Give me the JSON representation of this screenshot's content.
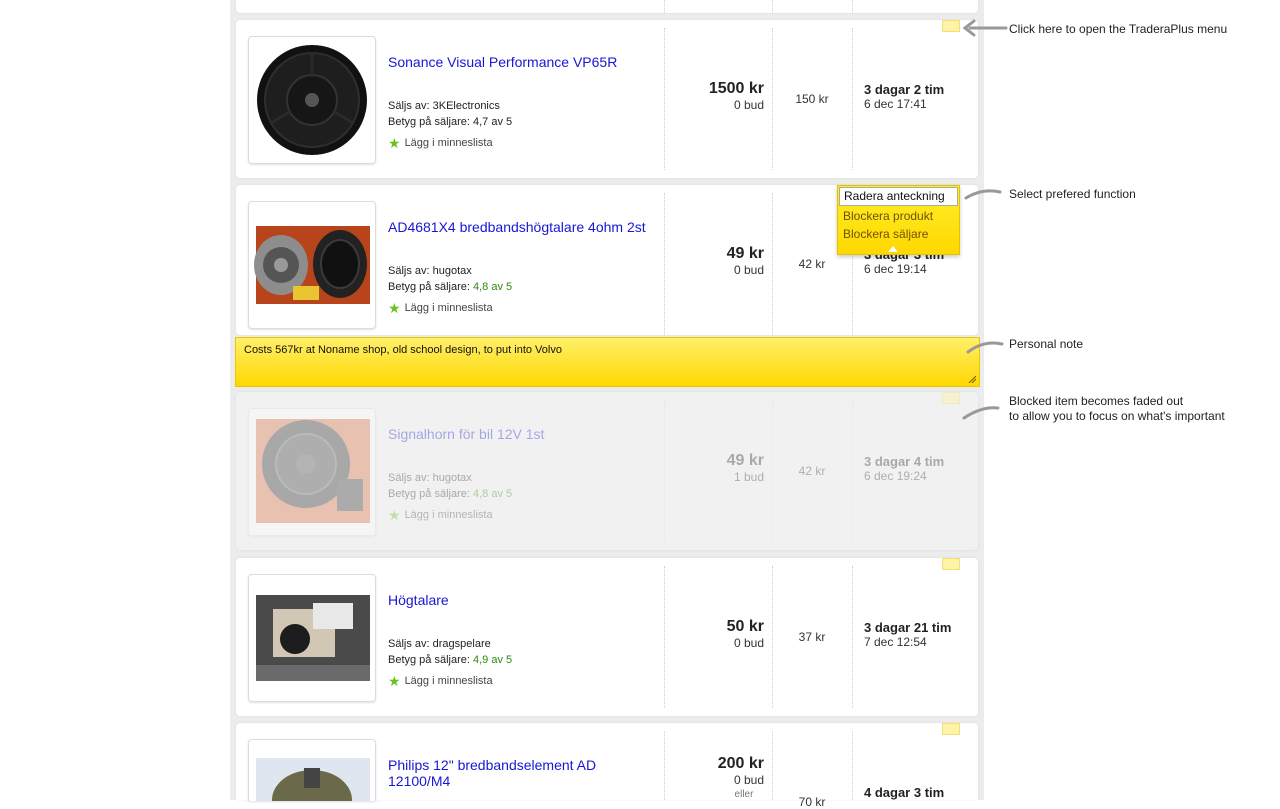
{
  "annotations": {
    "menu_hint": "Click here to open the TraderaPlus menu",
    "select_hint": "Select prefered function",
    "note_hint": "Personal note",
    "blocked_hint_line1": "Blocked item becomes faded out",
    "blocked_hint_line2": "to allow you to focus on what's important"
  },
  "menu": {
    "selected": "Radera anteckning",
    "options": [
      "Blockera produkt",
      "Blockera säljare"
    ]
  },
  "note": {
    "text": "Costs 567kr at Noname shop, old school design, to put into Volvo"
  },
  "items": [
    {
      "title": "Sonance Visual Performance VP65R",
      "seller": "Säljs av: 3KElectronics",
      "rating_label": "Betyg på säljare: ",
      "rating": "4,7 av 5",
      "wishlist": "Lägg i minneslista",
      "price": "1500 kr",
      "bids": "0 bud",
      "shipping": "150 kr",
      "time_left": "3 dagar 2 tim",
      "end_date": "6 dec 17:41"
    },
    {
      "title": "AD4681X4 bredbandshögtalare 4ohm 2st",
      "seller": "Säljs av: hugotax",
      "rating_label": "Betyg på säljare: ",
      "rating": "4,8 av 5",
      "wishlist": "Lägg i minneslista",
      "price": "49 kr",
      "bids": "0 bud",
      "shipping": "42 kr",
      "time_left": "3 dagar 3 tim",
      "end_date": "6 dec 19:14"
    },
    {
      "title": "Signalhorn för bil 12V 1st",
      "seller": "Säljs av: hugotax",
      "rating_label": "Betyg på säljare: ",
      "rating": "4,8 av 5",
      "wishlist": "Lägg i minneslista",
      "price": "49 kr",
      "bids": "1 bud",
      "shipping": "42 kr",
      "time_left": "3 dagar 4 tim",
      "end_date": "6 dec 19:24"
    },
    {
      "title": "Högtalare",
      "seller": "Säljs av: dragspelare",
      "rating_label": "Betyg på säljare: ",
      "rating": "4,9 av 5",
      "wishlist": "Lägg i minneslista",
      "price": "50 kr",
      "bids": "0 bud",
      "shipping": "37 kr",
      "time_left": "3 dagar 21 tim",
      "end_date": "7 dec 12:54"
    },
    {
      "title": "Philips 12\" bredbandselement AD 12100/M4",
      "price": "200 kr",
      "bids": "0 bud",
      "or_label": "eller",
      "shipping": "70 kr",
      "time_left": "4 dagar 3 tim"
    }
  ],
  "colors": {
    "link": "#1717d6",
    "rating_green": "#2a8a0f",
    "note_yellow": "#ffd700",
    "wishlist_star": "#6cc21d"
  }
}
